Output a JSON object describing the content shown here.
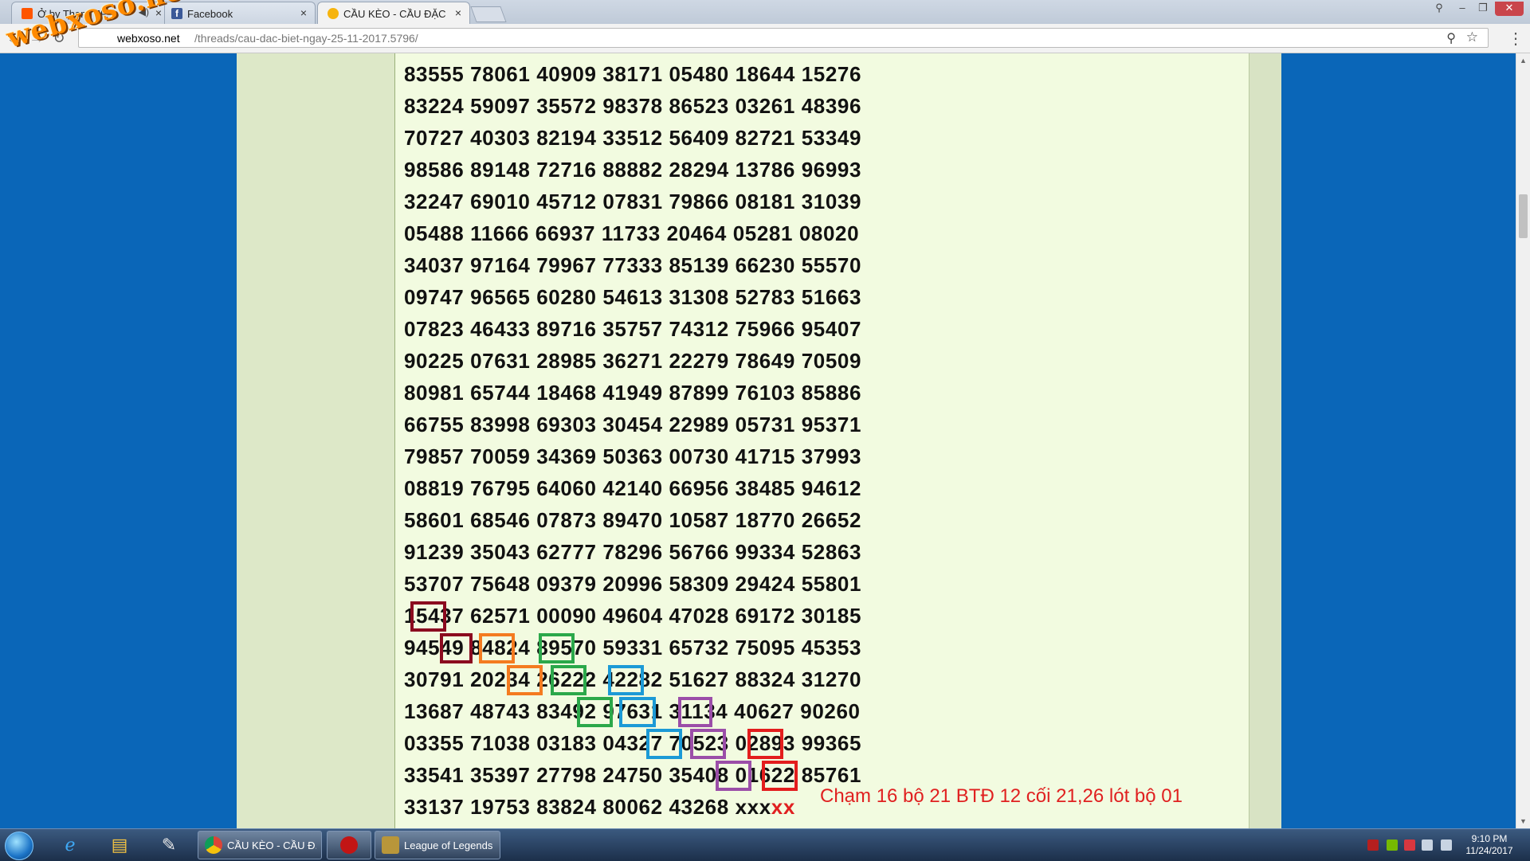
{
  "browser": {
    "tabs": [
      {
        "title": "Ở by Thang JP",
        "favicon_color": "#ff5500",
        "audio": true
      },
      {
        "title": "Facebook",
        "favicon_color": "#3b5998"
      },
      {
        "title": "CẦU KÈO - CẦU ĐẶC BIỆ",
        "favicon_color": "#f6b40e",
        "active": true
      }
    ],
    "url_domain": "webxoso.net",
    "url_path": "/threads/cau-dac-biet-ngay-25-11-2017.5796/",
    "watermark": "webxoso.net"
  },
  "post": {
    "rows": [
      "83555 78061 40909 38171 05480 18644 15276",
      "83224 59097 35572 98378 86523 03261 48396",
      "70727 40303 82194 33512 56409 82721 53349",
      "98586 89148 72716 88882 28294 13786 96993",
      "32247 69010 45712 07831 79866 08181 31039",
      "05488 11666 66937 11733 20464 05281 08020",
      "34037 97164 79967 77333 85139 66230 55570",
      "09747 96565 60280 54613 31308 52783 51663",
      "07823 46433 89716 35757 74312 75966 95407",
      "90225 07631 28985 36271 22279 78649 70509",
      "80981 65744 18468 41949 87899 76103 85886",
      "66755 83998 69303 30454 22989 05731 95371",
      "79857 70059 34369 50363 00730 41715 37993",
      "08819 76795 64060 42140 66956 38485 94612",
      "58601 68546 07873 89470 10587 18770 26652",
      "91239 35043 62777 78296 56766 99334 52863",
      "53707 75648 09379 20996 58309 29424 55801",
      "15437 62571 00090 49604 47028 69172 30185",
      "94549 84824 89570 59331 65732 75095 45353",
      "30791 20234 26222 42282 51627 88324 31270",
      "13687 48743 83492 97631 31134 40627 90260",
      "03355 71038 03183 04327 70523 02893 99365",
      "33541 35397 27798 24750 35408 01622 85761"
    ],
    "last_row_prefix": "33137 19753 83824 80062 43268 xxx",
    "last_row_red": "xx",
    "note": "Chạm 16 bộ 21 BTĐ 12 cối 21,26 lót bộ 01",
    "highlight_colors": {
      "maroon": "#8b0a1f",
      "orange": "#f47b20",
      "green": "#2ba84a",
      "blue": "#1c9ad6",
      "purple": "#9b4ea8",
      "red": "#e31d1d"
    }
  },
  "taskbar": {
    "tasks": [
      {
        "label": "CẦU KÈO - CẦU Đ...",
        "icon": "chrome-icon"
      },
      {
        "label": "",
        "icon": "garena-icon"
      },
      {
        "label": "League of Legends",
        "icon": "league-icon"
      }
    ],
    "clock_time": "9:10 PM",
    "clock_date": "11/24/2017"
  }
}
